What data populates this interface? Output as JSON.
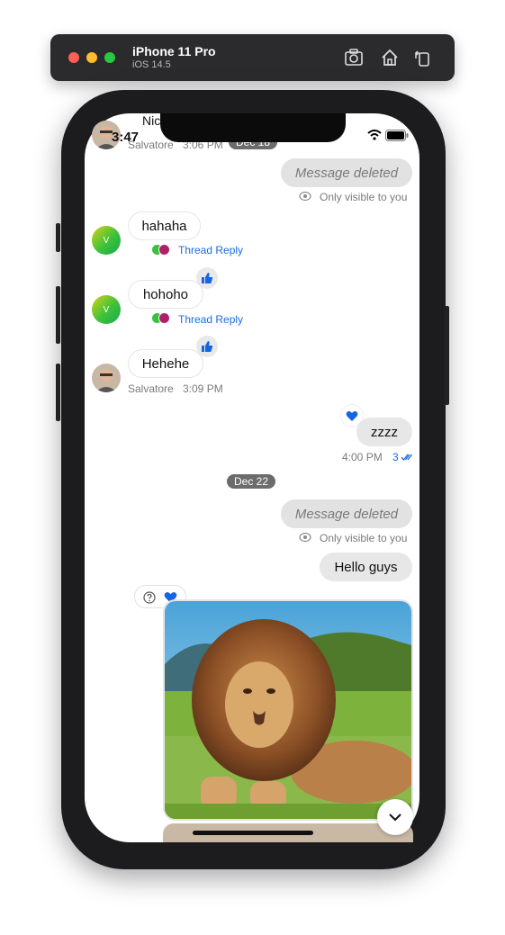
{
  "window": {
    "device": "iPhone 11 Pro",
    "os": "iOS 14.5"
  },
  "status_bar": {
    "time": "3:47"
  },
  "top_partial": {
    "sender_name": "Nic",
    "sender": "Salvatore",
    "time": "3:06 PM",
    "date_chip": "Dec 18"
  },
  "messages": {
    "deleted1": {
      "text": "Message deleted",
      "note": "Only visible to you"
    },
    "hahaha": {
      "text": "hahaha",
      "thread": "Thread Reply",
      "avatar_letter": "V"
    },
    "hohoho": {
      "text": "hohoho",
      "thread": "Thread Reply",
      "avatar_letter": "V"
    },
    "hehehe": {
      "text": "Hehehe",
      "sender": "Salvatore",
      "time": "3:09 PM"
    },
    "zzzz": {
      "text": "zzzz",
      "time": "4:00 PM",
      "read_count": "3"
    },
    "date_chip": "Dec 22",
    "deleted2": {
      "text": "Message deleted",
      "note": "Only visible to you"
    },
    "hello": {
      "text": "Hello guys"
    }
  },
  "colors": {
    "link": "#1a6de0",
    "reaction": "#1565e0"
  },
  "icons": [
    "screenshot-icon",
    "home-icon",
    "rotate-icon",
    "like-icon",
    "heart-icon",
    "question-icon",
    "eye-off-icon",
    "check-double-icon",
    "chevron-down-icon",
    "wifi-icon",
    "battery-icon"
  ]
}
